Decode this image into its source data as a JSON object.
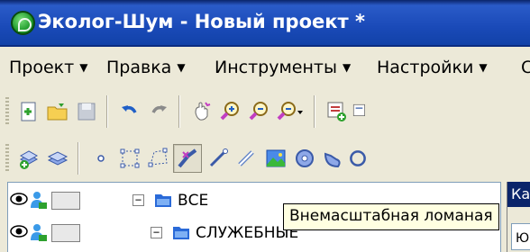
{
  "window": {
    "title": "Эколог-Шум - Новый проект *",
    "icon": "ecolog-app-icon"
  },
  "menu": {
    "items": [
      {
        "label": "Проект",
        "arrow": "▼"
      },
      {
        "label": "Правка",
        "arrow": "▼"
      },
      {
        "label": "Инструменты",
        "arrow": "▼"
      },
      {
        "label": "Настройки",
        "arrow": "▼"
      }
    ]
  },
  "toolbar1": {
    "buttons": [
      "new-file-icon",
      "open-folder-icon",
      "save-icon",
      "undo-icon",
      "redo-icon",
      "hand-pan-icon",
      "zoom-in-icon",
      "zoom-out-icon",
      "zoom-dropdown-icon",
      "add-layer-icon",
      "layer-copy-icon"
    ]
  },
  "toolbar2": {
    "buttons": [
      "add-layer-group-icon",
      "layer-stack-icon",
      "point-object-icon",
      "polygon-object-icon",
      "polyline-object-icon",
      "offscale-polyline-icon",
      "line-object-icon",
      "double-line-icon",
      "image-object-icon",
      "circle-object-icon",
      "sector-object-icon",
      "arc-object-icon"
    ],
    "pressed": "offscale-polyline-icon"
  },
  "tree": {
    "rows": [
      {
        "expander": "−",
        "label": "ВСЕ"
      },
      {
        "expander": "−",
        "label": "СЛУЖЕБНЫЕ"
      }
    ]
  },
  "right_panel": {
    "header": "Ка",
    "field": "Ю"
  },
  "tooltip": {
    "text": "Внемасштабная ломаная"
  },
  "colors": {
    "titlebar": "#1a4ab8",
    "chrome": "#ece9d8",
    "tooltip_bg": "#ffffe1",
    "folder": "#2a6ad8"
  }
}
